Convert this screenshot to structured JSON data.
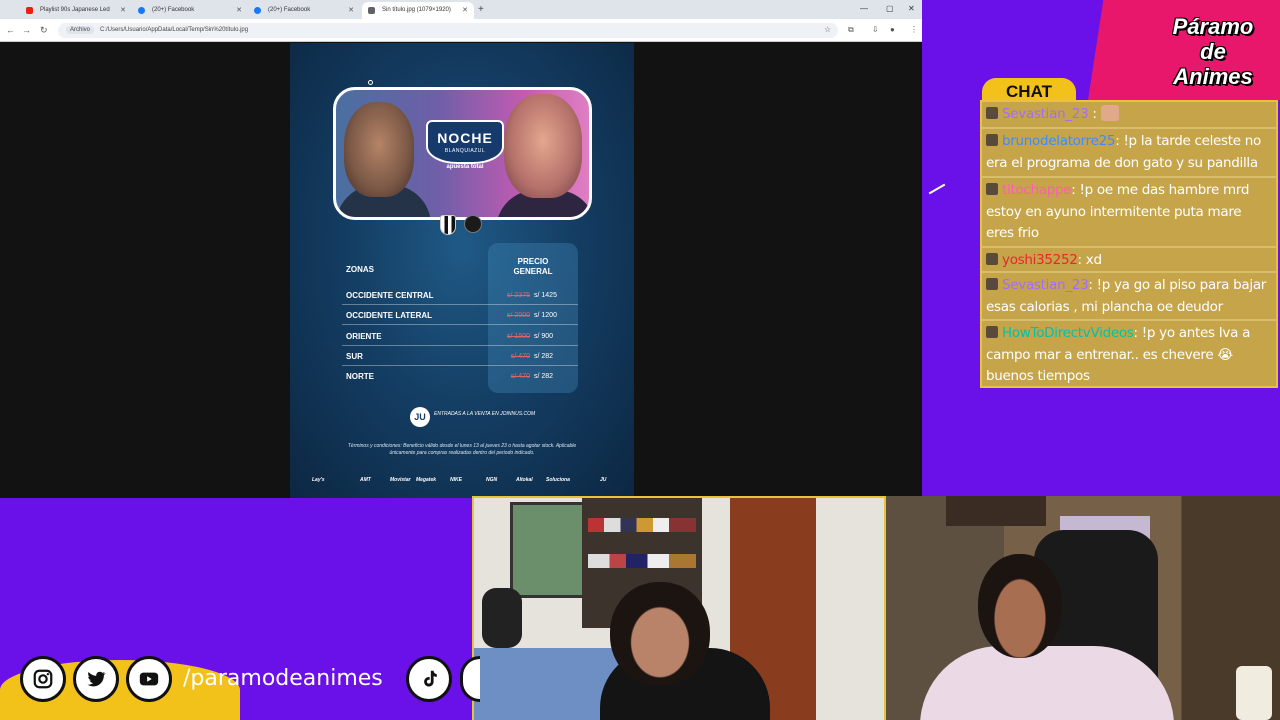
{
  "browser": {
    "tabs": [
      {
        "label": "Playlist 90s Japanese Led",
        "favicon_color": "#e62117"
      },
      {
        "label": "(20+) Facebook",
        "favicon_color": "#1877f2"
      },
      {
        "label": "(20+) Facebook",
        "favicon_color": "#1877f2"
      },
      {
        "label": "Sin título.jpg (1079×1920)",
        "favicon_color": "#5f6368"
      }
    ],
    "new_tab_glyph": "+",
    "address_chip": "Archivo",
    "address_url": "C:/Users/Usuario/AppData/Local/Temp/Sin%20título.jpg"
  },
  "poster": {
    "event_title": "NOCHE",
    "event_subtitle": "BLANQUIAZUL",
    "sponsor_tag": "apuesta total",
    "header_zones": "ZONAS",
    "header_price": "PRECIO GENERAL",
    "rows": [
      {
        "zone": "OCCIDENTE CENTRAL",
        "old_price": "s/ 2375",
        "new_price": "s/ 1425"
      },
      {
        "zone": "OCCIDENTE LATERAL",
        "old_price": "s/ 2000",
        "new_price": "s/ 1200"
      },
      {
        "zone": "ORIENTE",
        "old_price": "s/ 1500",
        "new_price": "s/ 900"
      },
      {
        "zone": "SUR",
        "old_price": "s/ 470",
        "new_price": "s/ 282"
      },
      {
        "zone": "NORTE",
        "old_price": "s/ 470",
        "new_price": "s/ 282"
      }
    ],
    "sale_logo": "JU",
    "sale_text": "ENTRADAS A LA VENTA EN JOINNUS.COM",
    "terms": "Términos y condiciones: Beneficio válido desde el lunes 13 al jueves 23 o hasta agotar stock. Aplicable únicamente para compras realizadas dentro del periodo indicado.",
    "sponsors": [
      "Lay's",
      "AMT",
      "Movistar",
      "Megatek",
      "NIKE",
      "NGN",
      "Altokal",
      "Soluciona",
      "JU"
    ]
  },
  "branding": {
    "line1": "Páramo",
    "line2": "de",
    "line3": "Animes"
  },
  "chat": {
    "title": "CHAT",
    "messages": [
      {
        "user": "Sevastian_23",
        "user_color": "#a36bff",
        "text": ""
      },
      {
        "user": "brunodelatorre25",
        "user_color": "#3c8cff",
        "text": ": !p la tarde celeste no era el programa de don gato y su pandilla"
      },
      {
        "user": "titochappe",
        "user_color": "#ff5cb8",
        "text": ": !p oe me das hambre mrd estoy en ayuno intermitente puta mare eres frio"
      },
      {
        "user": "yoshi35252",
        "user_color": "#e8262d",
        "text": ": xd"
      },
      {
        "user": "Sevastian_23",
        "user_color": "#a36bff",
        "text": ": !p ya go al piso para bajar esas calorias , mi plancha oe deudor"
      },
      {
        "user": "HowToDirectvVideos",
        "user_color": "#00c2a8",
        "text": ": !p yo antes Iva a campo mar a entrenar.. es chevere 😭 buenos tiempos"
      }
    ]
  },
  "social": {
    "handle": "/paramodeanimes",
    "icons": [
      "instagram-icon",
      "twitter-icon",
      "youtube-icon",
      "tiktok-icon"
    ]
  },
  "colors": {
    "stream_bg": "#6a10e8",
    "accent_pink": "#e8176b",
    "accent_yellow": "#f2c21a"
  }
}
